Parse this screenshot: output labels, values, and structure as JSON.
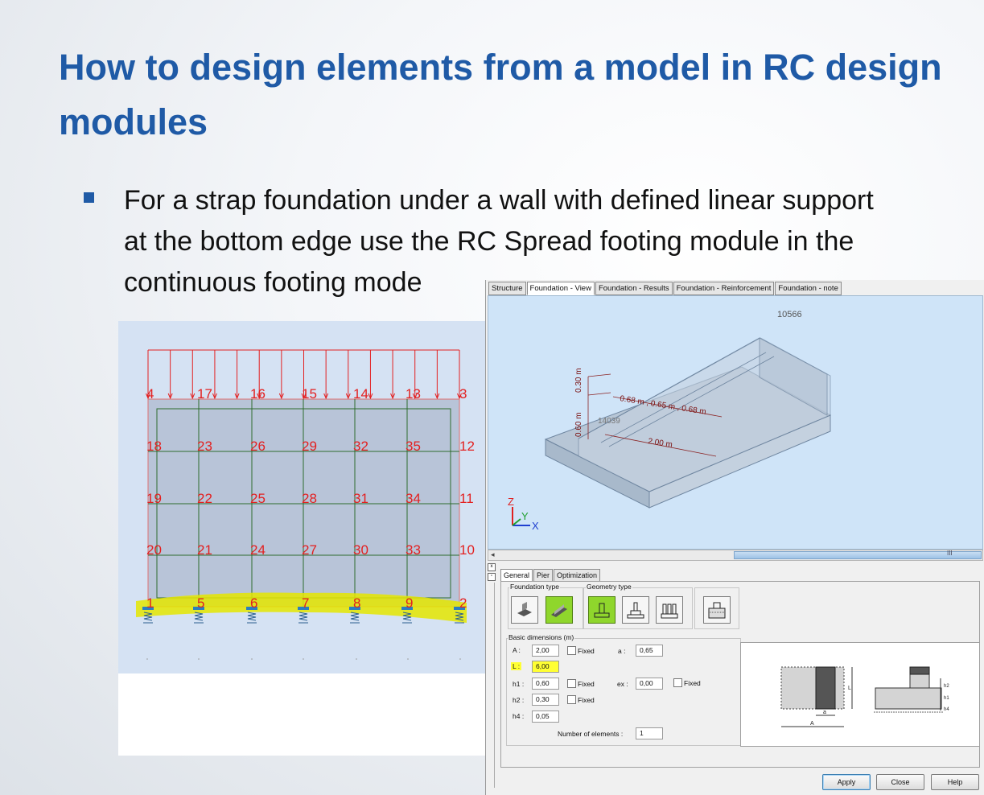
{
  "slide": {
    "title_line1": "How to design elements from a model in RC design",
    "title_line2": "modules",
    "bullet_line1": "For a strap foundation under a wall with defined linear support",
    "bullet_line2": "at the bottom edge use the RC Spread footing module in the",
    "bullet_line3": "continuous footing mode"
  },
  "model": {
    "top_labels": [
      "4",
      "17",
      "16",
      "15",
      "14",
      "13",
      "3"
    ],
    "row2_labels": [
      "18",
      "23",
      "26",
      "29",
      "32",
      "35",
      "12"
    ],
    "row3_labels": [
      "19",
      "22",
      "25",
      "28",
      "31",
      "34",
      "11"
    ],
    "row4_labels": [
      "20",
      "21",
      "24",
      "27",
      "30",
      "33",
      "10"
    ],
    "bottom_labels": [
      "1",
      "5",
      "6",
      "7",
      "8",
      "9",
      "2"
    ],
    "colors": {
      "load": "#e32020",
      "mesh": "#2e6b2e",
      "highlight": "#e4e600",
      "wall": "#b8c4d8"
    }
  },
  "dialog": {
    "top_tabs": [
      "Structure",
      "Foundation - View",
      "Foundation - Results",
      "Foundation - Reinforcement",
      "Foundation - note"
    ],
    "active_top_tab": "Foundation - View",
    "view3d": {
      "node_top": "10566",
      "node_mid": "14039",
      "dim_h1": "0.60 m",
      "dim_h2": "0.30 m",
      "dim_widths": "0.68 m , 0.65 m , 0.68 m",
      "dim_length": "2.00 m",
      "axis_z": "Z",
      "axis_y": "Y",
      "axis_x": "X"
    },
    "scroll_grip": "III",
    "lower_tabs": [
      "General",
      "Pier",
      "Optimization"
    ],
    "active_lower_tab": "General",
    "foundation_type_label": "Foundation type",
    "geometry_type_label": "Geometry type",
    "basic_dims_label": "Basic dimensions (m)",
    "fields": {
      "A_label": "A :",
      "A_value": "2,00",
      "L_label": "L :",
      "L_value": "6,00",
      "h1_label": "h1 :",
      "h1_value": "0,60",
      "h2_label": "h2 :",
      "h2_value": "0,30",
      "h4_label": "h4 :",
      "h4_value": "0,05",
      "a_label": "a :",
      "a_value": "0,65",
      "ex_label": "ex :",
      "ex_value": "0,00",
      "fixed_label": "Fixed",
      "num_elements_label": "Number of elements :",
      "num_elements_value": "1"
    },
    "preview": {
      "label_L": "L",
      "label_a": "a",
      "label_A": "A",
      "label_h2": "h2",
      "label_h1": "h1",
      "label_h4": "h4"
    },
    "buttons": {
      "apply": "Apply",
      "close": "Close",
      "help": "Help"
    },
    "colors": {
      "view_bg": "#cfe4f8",
      "active_button": "#8fd62c",
      "highlight": "#ffff33"
    }
  }
}
